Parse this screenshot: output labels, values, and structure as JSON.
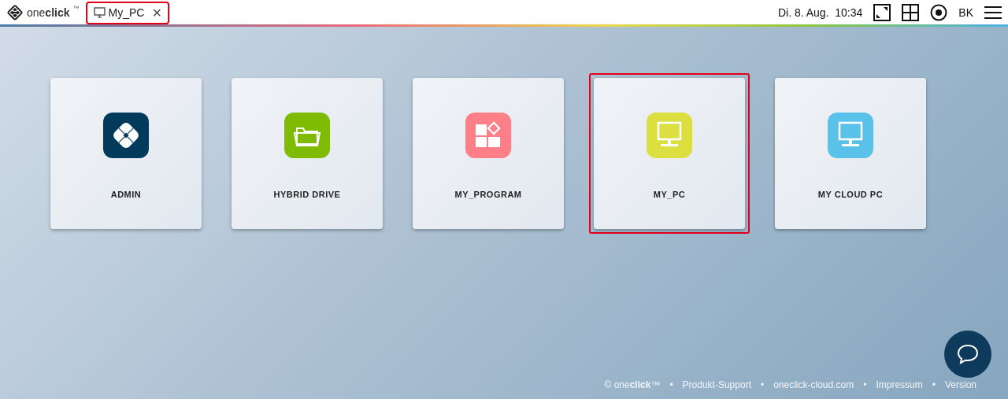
{
  "header": {
    "logo": "one**click**",
    "logo_mark": "™",
    "tabs": [
      {
        "label": "My_PC",
        "highlighted": true,
        "close": "×"
      }
    ],
    "date": "Di. 8. Aug.",
    "time": "10:34",
    "user": "BK"
  },
  "tiles": [
    {
      "label": "ADMIN",
      "kind": "admin",
      "color": "#023a5c",
      "highlighted": false
    },
    {
      "label": "HYBRID DRIVE",
      "kind": "folder",
      "color": "#7fbb00",
      "highlighted": false
    },
    {
      "label": "MY_PROGRAM",
      "kind": "program",
      "color": "#fe7f87",
      "highlighted": false
    },
    {
      "label": "MY_PC",
      "kind": "monitor",
      "color": "#dbe040",
      "highlighted": true
    },
    {
      "label": "MY CLOUD PC",
      "kind": "monitor",
      "color": "#5ac2e8",
      "highlighted": false
    }
  ],
  "footer": {
    "links": [
      "© one**click**™",
      "Produkt-Support",
      "oneclick-cloud.com",
      "Impressum",
      "Version"
    ],
    "separator": "•"
  }
}
